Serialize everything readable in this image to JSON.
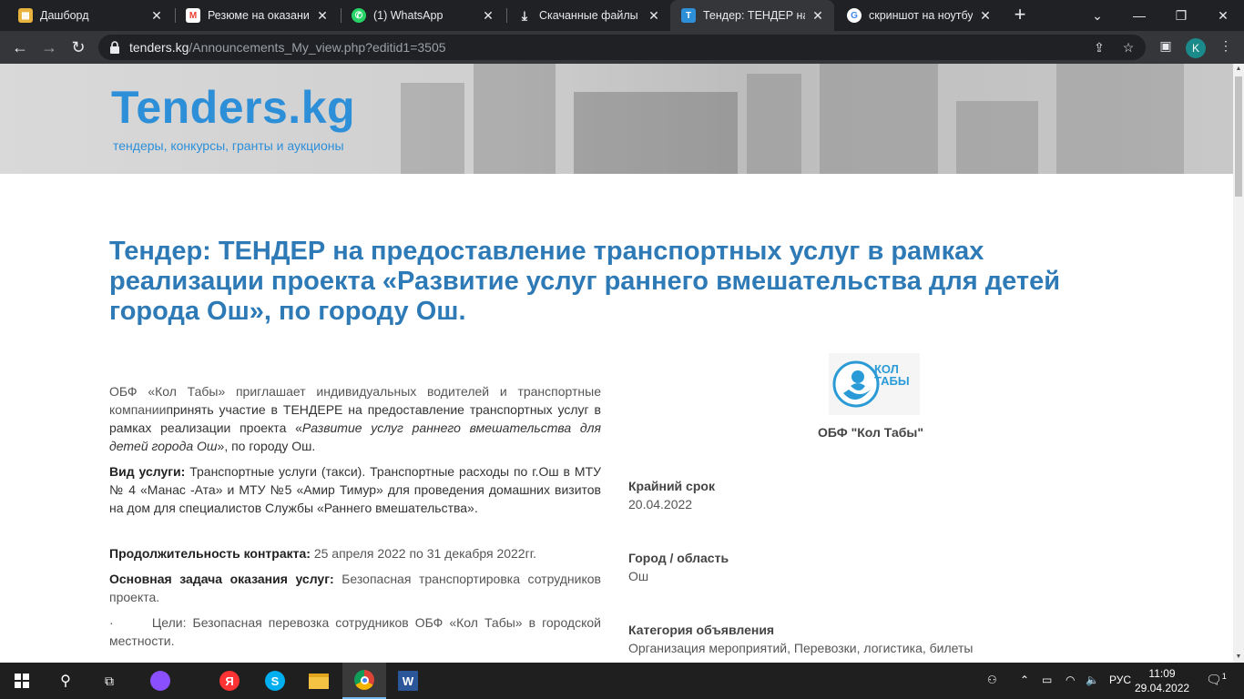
{
  "browser": {
    "tabs": [
      {
        "title": "Дашборд",
        "icon": "dashboard-icon",
        "color": "#e8b33d"
      },
      {
        "title": "Резюме на оказание",
        "icon": "gmail-icon",
        "color": "#ea4335"
      },
      {
        "title": "(1) WhatsApp",
        "icon": "whatsapp-icon",
        "color": "#25d366"
      },
      {
        "title": "Скачанные файлы",
        "icon": "download-icon",
        "color": "#e8eaed"
      },
      {
        "title": "Тендер: ТЕНДЕР на пр",
        "icon": "tenders-icon",
        "color": "#2d8fd8",
        "active": true
      },
      {
        "title": "скриншот на ноутбук",
        "icon": "google-icon",
        "color": "#4285f4"
      }
    ],
    "url_host": "tenders.kg",
    "url_path": "/Announcements_My_view.php?editid1=3505",
    "profile_initial": "K"
  },
  "site": {
    "brand": "Tenders.kg",
    "tagline": "тендеры, конкурсы, гранты и аукционы"
  },
  "tender": {
    "title": "Тендер: ТЕНДЕР на предоставление транспортных услуг в рамках реализации проекта «Развитие услуг раннего вмешательства для детей города Ош», по городу Ош.",
    "intro_plain": "ОБФ «Кол Табы» приглашает индивидуальных водителей и транспортные компании",
    "intro_dark": "принять участие в ТЕНДЕРЕ на предоставление транспортных услуг в рамках реализации проекта «",
    "intro_italic": "Развитие услуг раннего вмешательства для детей города Ош",
    "intro_end": "», по городу Ош.",
    "service_label": "Вид услуги:",
    "service_text": " Транспортные услуги (такси). Транспортные расходы по г.Ош в МТУ № 4 «Манас -Ата» и МТУ №5 «Амир Тимур» для проведения домашних визитов на дом для специалистов Службы «Раннего вмешательства».",
    "duration_label": "Продолжительность контракта:",
    "duration_text": " 25 апреля 2022 по 31 декабря 2022гг.",
    "task_label": "Основная задача оказания услуг:",
    "task_text": " Безопасная транспортировка сотрудников проекта.",
    "goals_bullet": "·",
    "goals_text": "Цели: Безопасная перевозка сотрудников ОБФ «Кол Табы» в городской местности."
  },
  "sidebar": {
    "logo_text_line1": "КОЛ",
    "logo_text_line2": "ТАБЫ",
    "org_name": "ОБФ \"Кол Табы\"",
    "deadline_label": "Крайний срок",
    "deadline_value": "20.04.2022",
    "city_label": "Город / область",
    "city_value": "Ош",
    "category_label": "Категория объявления",
    "category_value": "Организация мероприятий, Перевозки, логистика, билеты"
  },
  "taskbar": {
    "language": "РУС",
    "time": "11:09",
    "date": "29.04.2022",
    "notification_count": "1"
  }
}
